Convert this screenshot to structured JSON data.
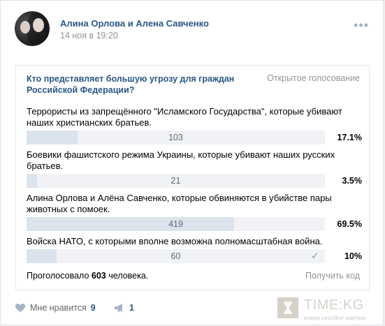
{
  "post": {
    "author": "Алина Орлова и Алена Савченко",
    "date": "14 ноя в 19:20",
    "more_icon": "more-dots-icon"
  },
  "poll": {
    "question": "Кто представляет большую угрозу для граждан Российской Федерации?",
    "type": "Открытое голосование",
    "answers": [
      {
        "text": "Террористы из запрещённого \"Исламского Государства\", которые убивают наших христианских братьев.",
        "count": "103",
        "percent": "17.1%",
        "fraction": 0.171,
        "voted": false
      },
      {
        "text": "Боевики фашистского режима Украины, которые убивают наших русских братьев.",
        "count": "21",
        "percent": "3.5%",
        "fraction": 0.035,
        "voted": false
      },
      {
        "text": "Алина Орлова и Алёна Савченко, которые обвиняются в убийстве пары животных с помоек.",
        "count": "419",
        "percent": "69.5%",
        "fraction": 0.695,
        "voted": false
      },
      {
        "text": "Войска НАТО, с которыми вполне возможна полномасштабная война.",
        "count": "60",
        "percent": "10%",
        "fraction": 0.1,
        "voted": true
      }
    ],
    "footer_prefix": "Проголосовало",
    "total_votes": "603",
    "footer_suffix": "человека.",
    "get_code": "Получить код"
  },
  "actions": {
    "like_label": "Мне нравится",
    "like_count": "9",
    "share_count": "1"
  },
  "watermark": {
    "title": "TIME:KG",
    "subtitle": "вчера сегодня завтра"
  },
  "colors": {
    "link": "#2a5885",
    "muted": "#939393",
    "bar_track": "#f0f2f5",
    "bar_fill": "#dbe3ec"
  }
}
